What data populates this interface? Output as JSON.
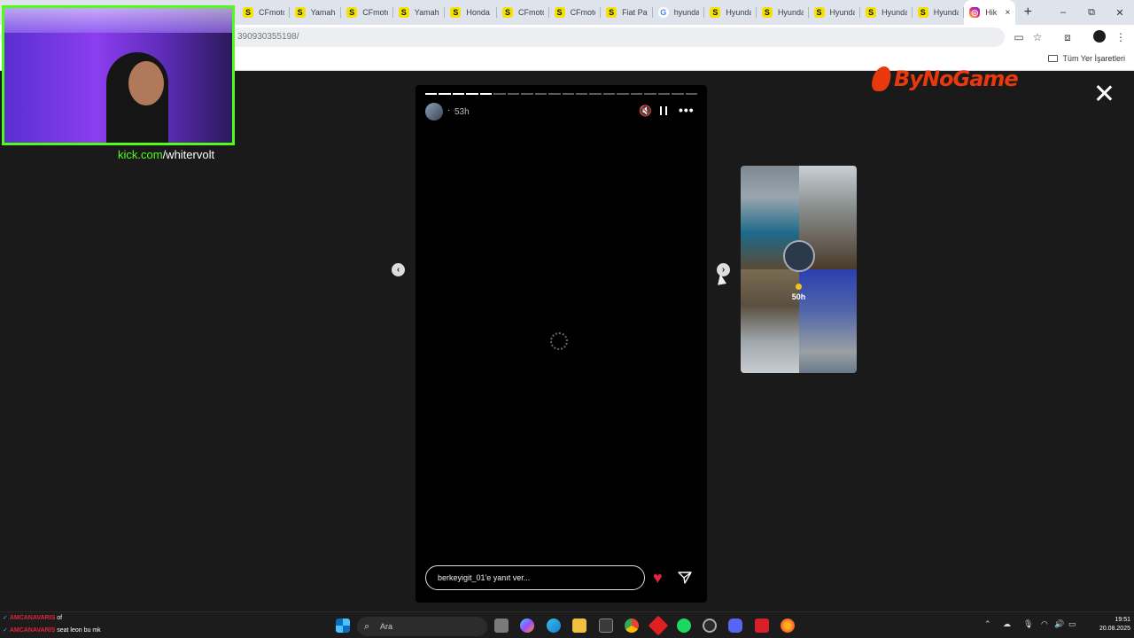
{
  "browser": {
    "tabs": [
      {
        "icon": "S",
        "title": "CFmoto"
      },
      {
        "icon": "S",
        "title": "Yamaha"
      },
      {
        "icon": "S",
        "title": "CFmoto"
      },
      {
        "icon": "S",
        "title": "Yamaha"
      },
      {
        "icon": "S",
        "title": "Honda"
      },
      {
        "icon": "S",
        "title": "CFmoto"
      },
      {
        "icon": "S",
        "title": "CFmoto"
      },
      {
        "icon": "S",
        "title": "Fiat Pa"
      },
      {
        "icon": "G",
        "title": "hyunda"
      },
      {
        "icon": "S",
        "title": "Hyunda"
      },
      {
        "icon": "S",
        "title": "Hyunda"
      },
      {
        "icon": "S",
        "title": "Hyunda"
      },
      {
        "icon": "S",
        "title": "Hyunda"
      },
      {
        "icon": "S",
        "title": "Hyunda"
      }
    ],
    "active_tab": {
      "title": "Hik",
      "close": "×"
    },
    "new_tab": "+",
    "window_controls": {
      "minimize": "–",
      "restore": "⧉",
      "close": "✕"
    },
    "url": "390930355198/",
    "bookmarks_all": "Tüm Yer İşaretleri"
  },
  "page": {
    "logo_text": "ByNoGame",
    "story": {
      "segments_total": 20,
      "segments_done": 5,
      "separator": "·",
      "time": "53h",
      "more": "•••",
      "mute_icon": "🔇",
      "reply_placeholder": "berkeyigit_01'e yanıt ver...",
      "heart": "♥"
    },
    "next_story": {
      "time": "50h"
    },
    "prev_arrow": "‹",
    "next_arrow": "›"
  },
  "overlay": {
    "kick_domain": "kick.com",
    "kick_path": "/whitervolt",
    "chat": [
      {
        "user": "AMCANAVARIS",
        "message": "of"
      },
      {
        "user": "AMCANAVARIS",
        "message": "seat leon bu mk"
      }
    ]
  },
  "taskbar": {
    "search_placeholder": "Ara",
    "time": "19:51",
    "date": "20.08.2025"
  },
  "colors": {
    "kick_green": "#53fc18",
    "brand_orange": "#e8380d",
    "heart_red": "#e0243e"
  }
}
